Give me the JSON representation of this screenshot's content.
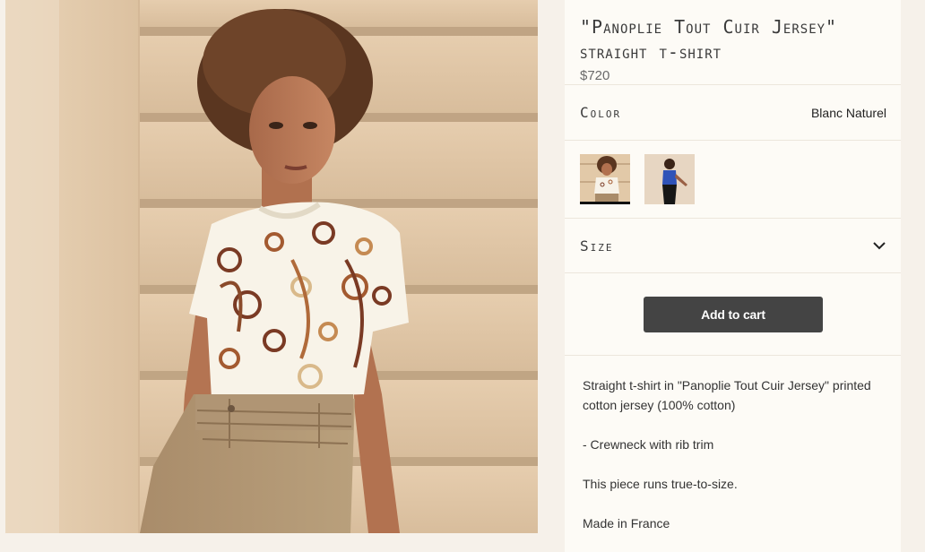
{
  "product": {
    "title_line1": "\"Panoplie Tout Cuir Jersey\"",
    "title_line2": "straight t-shirt",
    "price": "$720"
  },
  "color": {
    "label": "Color",
    "value": "Blanc Naturel",
    "swatches": [
      {
        "icon": "swatch-blanc-naturel",
        "selected": true
      },
      {
        "icon": "swatch-blue-variant",
        "selected": false
      }
    ]
  },
  "size": {
    "label": "Size",
    "icon": "chevron-down-icon"
  },
  "cart": {
    "button_label": "Add to cart"
  },
  "description": {
    "paragraphs": [
      "Straight t-shirt in \"Panoplie Tout Cuir Jersey\" printed cotton jersey (100% cotton)",
      "- Crewneck with rib trim",
      "This piece runs true-to-size.",
      "Made in France"
    ]
  },
  "colors": {
    "page_bg": "#f6f1ea",
    "panel_bg": "#fdfbf6",
    "button_bg": "#444444",
    "button_text": "#ffffff"
  }
}
